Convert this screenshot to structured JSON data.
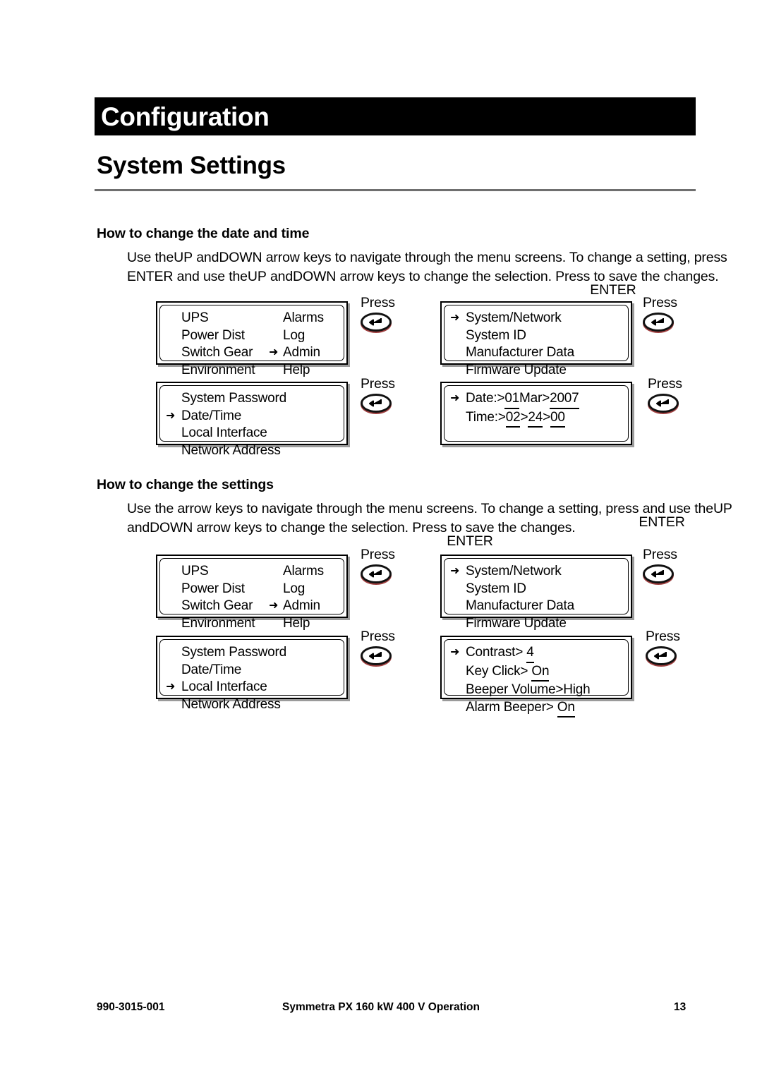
{
  "chapter": {
    "title": "Configuration"
  },
  "section": {
    "title": "System Settings"
  },
  "sections": [
    {
      "heading": "How to change the date and time",
      "paragraph": {
        "line1_a": "Use the",
        "line1_sc1": "UP",
        "line1_b": " and",
        "line1_sc2": "DOWN",
        "line1_c": " arrow keys to navigate through the menu screens. To change a setting, press",
        "line2_sc1": "ENTER",
        "line2_a": " and use the",
        "line2_sc2": "UP",
        "line2_b": " and",
        "line2_sc3": "DOWN",
        "line2_c": " arrow keys to change the selection. Press",
        "line2_overlap1": "Press",
        "line2_overlap2": "ENTER",
        "line2_d": " to save the changes."
      }
    },
    {
      "heading": "How to change the settings",
      "paragraph": {
        "line1_a": "Use the arrow keys to navigate through the menu screens. To change a setting, press",
        "line1_overlap1": "ENTER",
        "line1_overlap2": ", press",
        "line1_b": " and use",
        "line2_a": "the",
        "line2_sc1": "UP",
        "line2_b": " and",
        "line2_sc2": "DOWN",
        "line2_c": " arrow keys to change the selection. Press",
        "line2_overlap1": "Press",
        "line2_overlap2": "ENTER",
        "line2_d": " to save the changes."
      }
    }
  ],
  "press_label": "Press",
  "enter_icon": "enter-key-icon",
  "selector_arrow": "➜",
  "screens": {
    "main_menu_1": {
      "name": "main-menu",
      "rows": [
        {
          "left": "UPS",
          "selected_right": false,
          "right": "Alarms"
        },
        {
          "left": "Power Dist",
          "selected_right": false,
          "right": "Log"
        },
        {
          "left": "Switch Gear",
          "selected_right": true,
          "right": "Admin"
        },
        {
          "left": "Environment",
          "selected_right": false,
          "right": "Help"
        }
      ]
    },
    "admin_menu_1": {
      "name": "admin-menu",
      "rows": [
        {
          "selected": true,
          "text": "System/Network"
        },
        {
          "selected": false,
          "text": "System ID"
        },
        {
          "selected": false,
          "text": "Manufacturer Data"
        },
        {
          "selected": false,
          "text": "Firmware Update"
        }
      ]
    },
    "system_network_menu_1": {
      "name": "system-network-menu",
      "rows": [
        {
          "selected": false,
          "text": "System Password"
        },
        {
          "selected": true,
          "text": "Date/Time"
        },
        {
          "selected": false,
          "text": "Local Interface"
        },
        {
          "selected": false,
          "text": "Network Address"
        }
      ]
    },
    "date_time_screen": {
      "name": "date-time-screen",
      "rows": [
        {
          "selected": true,
          "label": "Date:>",
          "fields": [
            {
              "value": "01",
              "cursor": true
            },
            {
              "value": "Mar",
              "cursor": false,
              "prefix": ""
            },
            {
              "value": "2007",
              "cursor": true,
              "prefix": ">"
            }
          ]
        },
        {
          "selected": false,
          "label": "Time:>",
          "fields": [
            {
              "value": "02",
              "cursor": true
            },
            {
              "value": "24",
              "cursor": true,
              "prefix": ">"
            },
            {
              "value": "00",
              "cursor": true,
              "prefix": ">"
            }
          ]
        }
      ]
    },
    "main_menu_2": {
      "name": "main-menu",
      "rows": [
        {
          "left": "UPS",
          "selected_right": false,
          "right": "Alarms"
        },
        {
          "left": "Power Dist",
          "selected_right": false,
          "right": "Log"
        },
        {
          "left": "Switch Gear",
          "selected_right": true,
          "right": "Admin"
        },
        {
          "left": "Environment",
          "selected_right": false,
          "right": "Help"
        }
      ]
    },
    "admin_menu_2": {
      "name": "admin-menu",
      "rows": [
        {
          "selected": true,
          "text": "System/Network"
        },
        {
          "selected": false,
          "text": "System ID"
        },
        {
          "selected": false,
          "text": "Manufacturer Data"
        },
        {
          "selected": false,
          "text": "Firmware Update"
        }
      ]
    },
    "system_network_menu_2": {
      "name": "system-network-menu",
      "rows": [
        {
          "selected": false,
          "text": "System Password"
        },
        {
          "selected": false,
          "text": "Date/Time"
        },
        {
          "selected": true,
          "text": "Local Interface"
        },
        {
          "selected": false,
          "text": "Network Address"
        }
      ]
    },
    "local_interface_screen": {
      "name": "local-interface-screen",
      "rows": [
        {
          "selected": true,
          "label": "Contrast>",
          "value": "4",
          "cursor": true
        },
        {
          "selected": false,
          "label": "Key Click>",
          "value": "On",
          "cursor": true
        },
        {
          "selected": false,
          "label": "Beeper Volume>",
          "value": "High",
          "cursor": false
        },
        {
          "selected": false,
          "label": "Alarm Beeper>",
          "value": "On",
          "cursor": true
        }
      ]
    }
  },
  "footer": {
    "part_number": "990-3015-001",
    "document_title": "Symmetra PX 160 kW 400 V Operation",
    "page_number": "13"
  }
}
